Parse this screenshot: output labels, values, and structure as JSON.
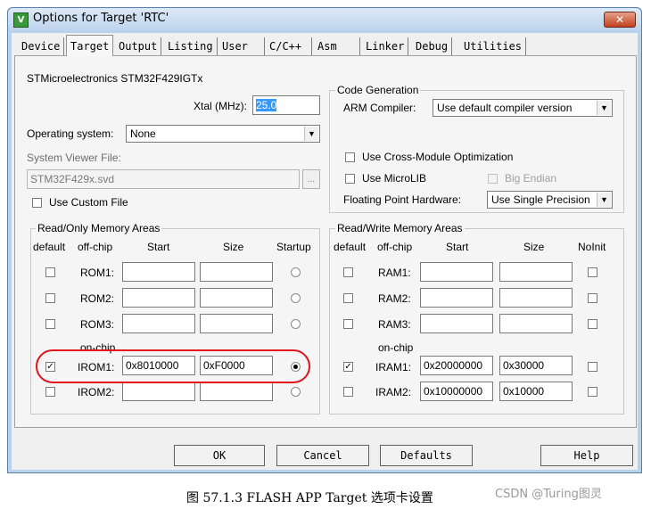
{
  "window": {
    "title": "Options for Target 'RTC'",
    "icon": "keil-icon",
    "close_glyph": "✕"
  },
  "tabs": [
    {
      "label": "Device",
      "active": false
    },
    {
      "label": "Target",
      "active": true
    },
    {
      "label": "Output",
      "active": false
    },
    {
      "label": "Listing",
      "active": false
    },
    {
      "label": "User",
      "active": false
    },
    {
      "label": "C/C++",
      "active": false
    },
    {
      "label": "Asm",
      "active": false
    },
    {
      "label": "Linker",
      "active": false
    },
    {
      "label": "Debug",
      "active": false
    },
    {
      "label": "Utilities",
      "active": false
    }
  ],
  "device_name": "STMicroelectronics STM32F429IGTx",
  "xtal": {
    "label": "Xtal (MHz):",
    "value": "25.0"
  },
  "os": {
    "label": "Operating system:",
    "value": "None"
  },
  "svd": {
    "label": "System Viewer File:",
    "value": "STM32F429x.svd",
    "browse": "..."
  },
  "use_custom_file": {
    "label": "Use Custom File",
    "checked": false
  },
  "codegen": {
    "title": "Code Generation",
    "arm_compiler_label": "ARM Compiler:",
    "arm_compiler_value": "Use default compiler version",
    "cross_module": {
      "label": "Use Cross-Module Optimization",
      "checked": false
    },
    "microlib": {
      "label": "Use MicroLIB",
      "checked": false
    },
    "big_endian": {
      "label": "Big Endian",
      "checked": false
    },
    "fpu_label": "Floating Point Hardware:",
    "fpu_value": "Use Single Precision"
  },
  "rom": {
    "title": "Read/Only Memory Areas",
    "headers": {
      "default": "default",
      "offchip": "off-chip",
      "start": "Start",
      "size": "Size",
      "startup": "Startup"
    },
    "onchip_label": "on-chip",
    "rows": [
      {
        "name": "ROM1:",
        "default": false,
        "start": "",
        "size": "",
        "startup": false
      },
      {
        "name": "ROM2:",
        "default": false,
        "start": "",
        "size": "",
        "startup": false
      },
      {
        "name": "ROM3:",
        "default": false,
        "start": "",
        "size": "",
        "startup": false
      },
      {
        "name": "IROM1:",
        "default": true,
        "start": "0x8010000",
        "size": "0xF0000",
        "startup": true
      },
      {
        "name": "IROM2:",
        "default": false,
        "start": "",
        "size": "",
        "startup": false
      }
    ]
  },
  "ram": {
    "title": "Read/Write Memory Areas",
    "headers": {
      "default": "default",
      "offchip": "off-chip",
      "start": "Start",
      "size": "Size",
      "noinit": "NoInit"
    },
    "onchip_label": "on-chip",
    "rows": [
      {
        "name": "RAM1:",
        "default": false,
        "start": "",
        "size": "",
        "noinit": false
      },
      {
        "name": "RAM2:",
        "default": false,
        "start": "",
        "size": "",
        "noinit": false
      },
      {
        "name": "RAM3:",
        "default": false,
        "start": "",
        "size": "",
        "noinit": false
      },
      {
        "name": "IRAM1:",
        "default": true,
        "start": "0x20000000",
        "size": "0x30000",
        "noinit": false
      },
      {
        "name": "IRAM2:",
        "default": false,
        "start": "0x10000000",
        "size": "0x10000",
        "noinit": false
      }
    ]
  },
  "buttons": {
    "ok": "OK",
    "cancel": "Cancel",
    "defaults": "Defaults",
    "help": "Help"
  },
  "caption": "图 57.1.3 FLASH APP Target 选项卡设置",
  "watermark": "CSDN @Turing图灵",
  "colors": {
    "highlight": "#e0131b",
    "selection": "#3399ff"
  }
}
